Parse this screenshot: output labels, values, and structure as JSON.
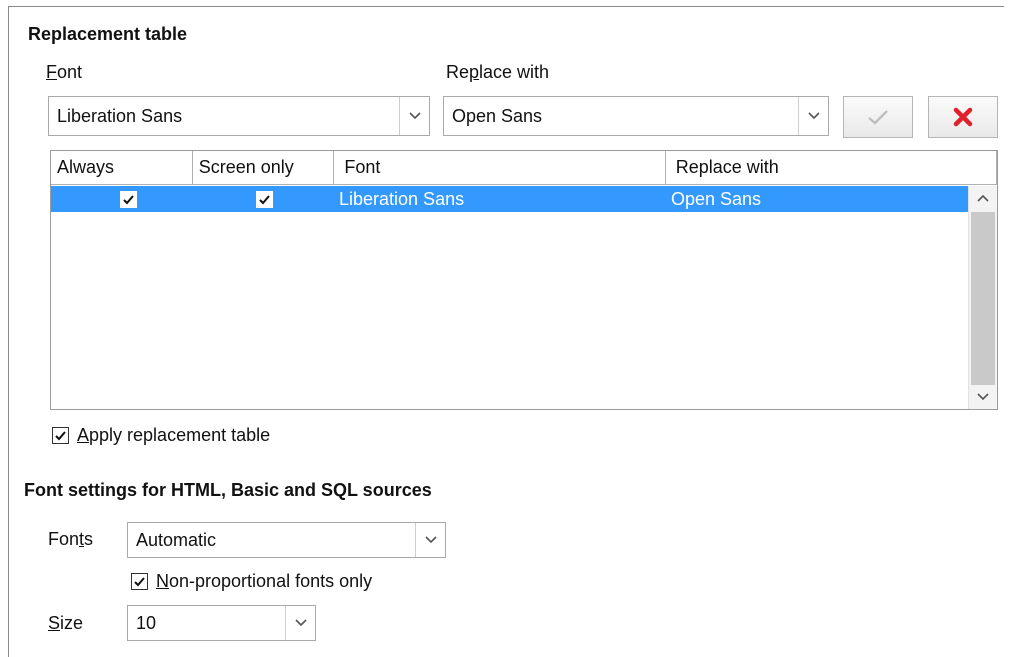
{
  "replacement": {
    "title": "Replacement table",
    "font_label_key": "F",
    "font_label_rest": "ont",
    "replace_label_pre": "Re",
    "replace_label_key": "p",
    "replace_label_rest": "lace with",
    "font_value": "Liberation Sans",
    "replace_value": "Open Sans",
    "apply_icon": "check-icon",
    "delete_icon": "delete-x-icon"
  },
  "table": {
    "headers": [
      "Always",
      "Screen only",
      "Font",
      "Replace with"
    ],
    "rows": [
      {
        "always": true,
        "screen_only": true,
        "font": "Liberation Sans",
        "replace_with": "Open Sans"
      }
    ]
  },
  "apply_table": {
    "checked": true,
    "label_key": "A",
    "label_rest": "pply replacement table"
  },
  "source_fonts": {
    "title": "Font settings for HTML, Basic and SQL sources",
    "fonts_label_pre": "Fon",
    "fonts_label_key": "t",
    "fonts_label_rest": "s",
    "fonts_value": "Automatic",
    "nonprop_checked": true,
    "nonprop_key": "N",
    "nonprop_rest": "on-proportional fonts only",
    "size_label_key": "S",
    "size_label_rest": "ize",
    "size_value": "10"
  },
  "colors": {
    "selection": "#3399ff",
    "delete_red": "#e0202a"
  }
}
